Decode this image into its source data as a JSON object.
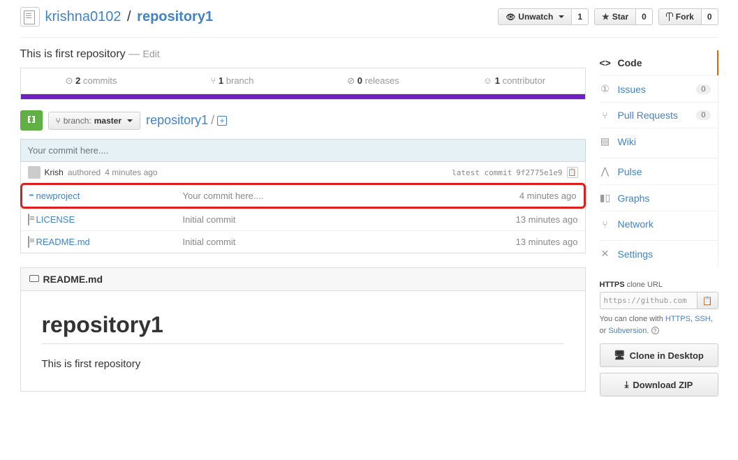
{
  "repo": {
    "owner": "krishna0102",
    "name": "repository1"
  },
  "actions": {
    "unwatch": {
      "label": "Unwatch",
      "count": "1"
    },
    "star": {
      "label": "Star",
      "count": "0"
    },
    "fork": {
      "label": "Fork",
      "count": "0"
    }
  },
  "description": {
    "text": "This is first repository",
    "edit": "Edit"
  },
  "summary": {
    "commits": {
      "n": "2",
      "label": "commits"
    },
    "branches": {
      "n": "1",
      "label": "branch"
    },
    "releases": {
      "n": "0",
      "label": "releases"
    },
    "contributors": {
      "n": "1",
      "label": "contributor"
    }
  },
  "branch": {
    "label": "branch:",
    "value": "master"
  },
  "breadcrumb": {
    "root": "repository1",
    "sep": "/"
  },
  "tease": {
    "message": "Your commit here...."
  },
  "latest": {
    "author": "Krish",
    "verb": "authored",
    "age": "4 minutes ago",
    "label": "latest commit",
    "hash": "9f2775e1e9"
  },
  "files": [
    {
      "type": "folder",
      "name": "newproject",
      "msg": "Your commit here....",
      "age": "4 minutes ago",
      "hl": true
    },
    {
      "type": "file",
      "name": "LICENSE",
      "msg": "Initial commit",
      "age": "13 minutes ago",
      "hl": false
    },
    {
      "type": "file",
      "name": "README.md",
      "msg": "Initial commit",
      "age": "13 minutes ago",
      "hl": false
    }
  ],
  "readme": {
    "filename": "README.md",
    "title": "repository1",
    "body": "This is first repository"
  },
  "sidebar": {
    "code": "Code",
    "issues": {
      "label": "Issues",
      "count": "0"
    },
    "pulls": {
      "label": "Pull Requests",
      "count": "0"
    },
    "wiki": "Wiki",
    "pulse": "Pulse",
    "graphs": "Graphs",
    "network": "Network",
    "settings": "Settings"
  },
  "clone": {
    "proto": "HTTPS",
    "label_suffix": "clone URL",
    "url": "https://github.com",
    "help_prefix": "You can clone with ",
    "https": "HTTPS",
    "ssh": "SSH",
    "or": "or ",
    "svn": "Subversion",
    "desktop": "Clone in Desktop",
    "zip": "Download ZIP"
  }
}
